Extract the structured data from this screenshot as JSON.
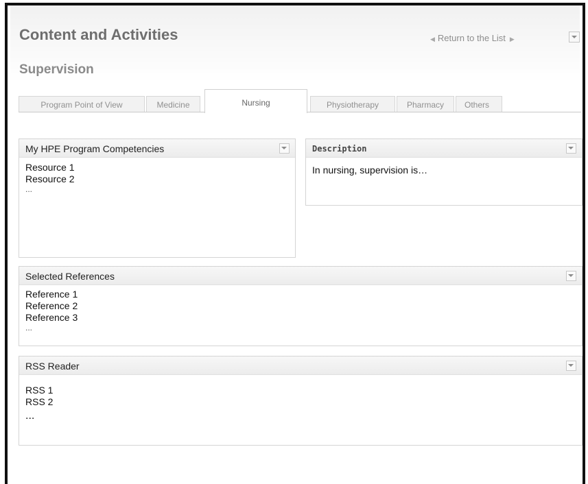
{
  "header": {
    "title": "Content and Activities",
    "subtitle": "Supervision",
    "return_link": "Return to the List"
  },
  "tabs": [
    {
      "label": "Program Point of View",
      "active": false
    },
    {
      "label": "Medicine",
      "active": false
    },
    {
      "label": "Nursing",
      "active": true
    },
    {
      "label": "Physiotherapy",
      "active": false
    },
    {
      "label": "Pharmacy",
      "active": false
    },
    {
      "label": "Others",
      "active": false
    }
  ],
  "panels": {
    "competencies": {
      "title": "My HPE Program Competencies",
      "items": [
        "Resource 1",
        "Resource 2",
        "..."
      ]
    },
    "description": {
      "title": "Description",
      "text": "In nursing, supervision is…"
    },
    "references": {
      "title": "Selected References",
      "items": [
        "Reference 1",
        "Reference 2",
        "Reference 3",
        "..."
      ]
    },
    "rss": {
      "title": "RSS Reader",
      "items": [
        "RSS 1",
        "RSS 2",
        "..."
      ]
    }
  },
  "icons": {
    "dropdown": "chevron-down-icon",
    "arrow_left": "triangle-left-icon",
    "arrow_right": "triangle-right-icon"
  }
}
